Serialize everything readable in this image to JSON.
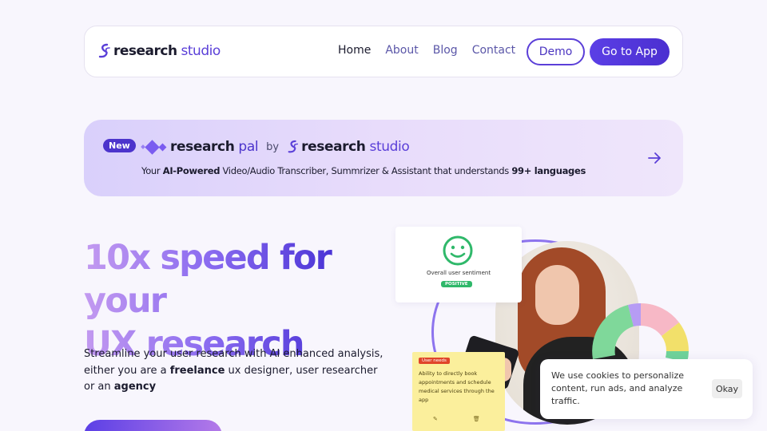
{
  "nav": {
    "logo": {
      "bold": "research",
      "light": "studio"
    },
    "links": [
      {
        "label": "Home",
        "active": true
      },
      {
        "label": "About",
        "active": false
      },
      {
        "label": "Blog",
        "active": false
      },
      {
        "label": "Contact",
        "active": false
      }
    ],
    "demo_label": "Demo",
    "app_label": "Go to App"
  },
  "banner": {
    "badge": "New",
    "product_bold": "research",
    "product_light": "pal",
    "by": "by",
    "brand_bold": "research",
    "brand_light": "studio",
    "subtitle_pre": "Your ",
    "subtitle_b1": "AI-Powered",
    "subtitle_mid": " Video/Audio Transcriber, Summrizer & Assistant that understands ",
    "subtitle_b2": "99+ languages"
  },
  "hero": {
    "title_line1": "10x speed for your",
    "title_line2": "UX research",
    "desc_pre": "Streamline your user research with AI enhanced analysis, either you are a ",
    "desc_b1": "freelance",
    "desc_mid": " ux designer, user researcher or an ",
    "desc_b2": "agency"
  },
  "collage": {
    "sentiment_label": "Overall user sentiment",
    "sentiment_badge": "POSITIVE",
    "note_tag": "User needs",
    "note_text": "Ability to directly book appointments and schedule medical services through the app"
  },
  "cookie": {
    "text": "We use cookies to personalize content, run ads, and analyze traffic.",
    "ok_label": "Okay"
  },
  "colors": {
    "accent": "#4c34cc",
    "banner_bg": "#e3dafb",
    "positive": "#2fb86a"
  }
}
